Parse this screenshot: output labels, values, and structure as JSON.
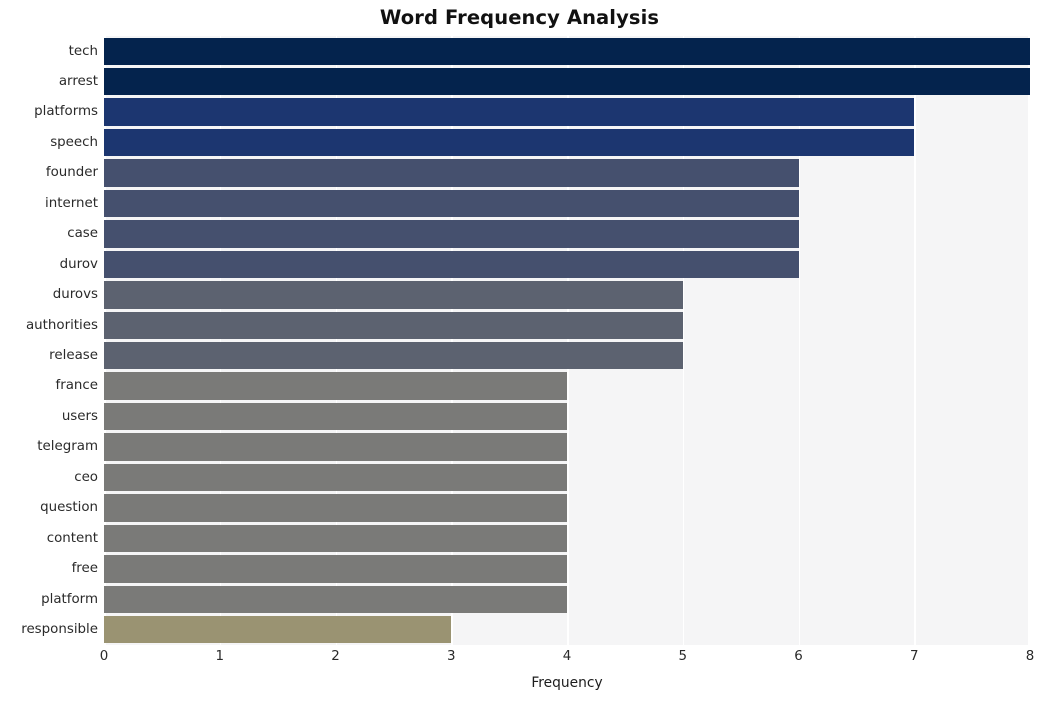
{
  "chart_data": {
    "type": "bar",
    "orientation": "horizontal",
    "title": "Word Frequency Analysis",
    "xlabel": "Frequency",
    "ylabel": "",
    "xlim": [
      0,
      8
    ],
    "xticks": [
      "0",
      "1",
      "2",
      "3",
      "4",
      "5",
      "6",
      "7",
      "8"
    ],
    "grid": true,
    "legend": "none",
    "categories": [
      "tech",
      "arrest",
      "platforms",
      "speech",
      "founder",
      "internet",
      "case",
      "durov",
      "durovs",
      "authorities",
      "release",
      "france",
      "users",
      "telegram",
      "ceo",
      "question",
      "content",
      "free",
      "platform",
      "responsible"
    ],
    "values": [
      8,
      8,
      7,
      7,
      6,
      6,
      6,
      6,
      5,
      5,
      5,
      4,
      4,
      4,
      4,
      4,
      4,
      4,
      4,
      3
    ],
    "bar_colors": [
      "#04234d",
      "#04234d",
      "#1c3670",
      "#1c3670",
      "#45506e",
      "#45506e",
      "#45506e",
      "#45506e",
      "#5c6270",
      "#5c6270",
      "#5c6270",
      "#7a7a78",
      "#7a7a78",
      "#7a7a78",
      "#7a7a78",
      "#7a7a78",
      "#7a7a78",
      "#7a7a78",
      "#7a7a78",
      "#9a9372"
    ],
    "plot_background": "#f5f5f6",
    "gridline_color": "#ffffff",
    "figure_background": "#ffffff",
    "title_color": "#111111",
    "tick_label_color": "#2a2a2a"
  }
}
